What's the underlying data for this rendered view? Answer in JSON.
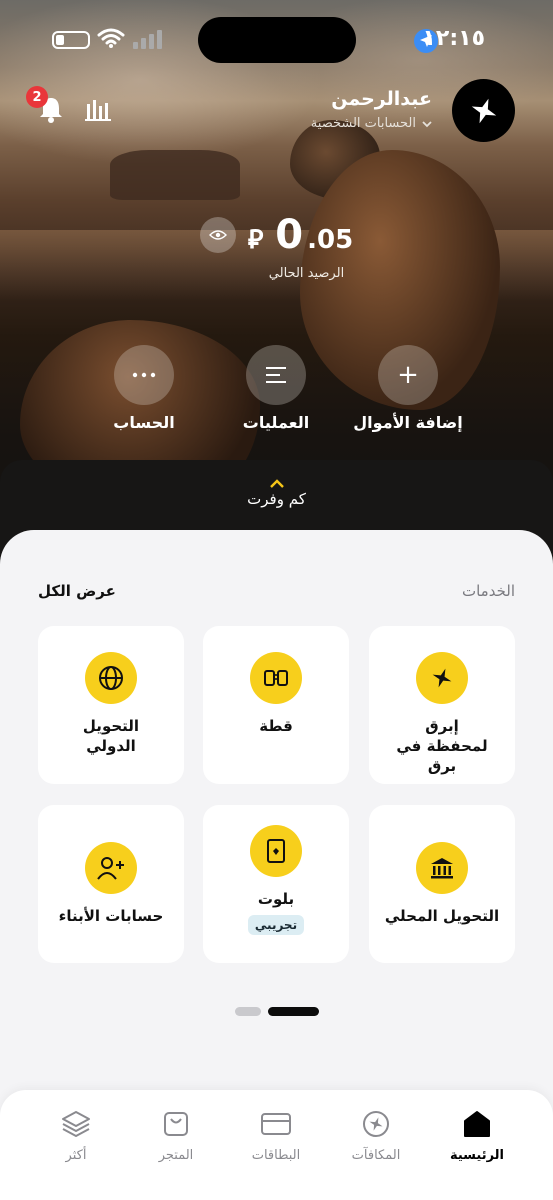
{
  "status_bar": {
    "time": "١٢:١٥"
  },
  "header": {
    "user_name": "عبدالرحمن",
    "account_type": "الحسابات الشخصية",
    "notifications_count": "2"
  },
  "balance": {
    "amount_whole": "0",
    "amount_decimal": ".05",
    "currency_symbol": "⃁",
    "label": "الرصيد الحالي"
  },
  "actions": [
    {
      "label": "إضافة الأموال",
      "icon": "plus-icon"
    },
    {
      "label": "العمليات",
      "icon": "list-icon"
    },
    {
      "label": "الحساب",
      "icon": "more-icon"
    }
  ],
  "savings": {
    "label": "كم وفرت"
  },
  "services": {
    "title": "الخدمات",
    "view_all": "عرض الكل",
    "cards": [
      {
        "name": "إبرق لمحفظة في برق",
        "icon": "sparkle-icon"
      },
      {
        "name": "قطة",
        "icon": "split-icon"
      },
      {
        "name": "التحويل الدولي",
        "icon": "globe-icon"
      },
      {
        "name": "التحويل المحلي",
        "icon": "bank-icon"
      },
      {
        "name": "بلوت",
        "icon": "cards-icon",
        "tag": "تجريبي"
      },
      {
        "name": "حسابات الأبناء",
        "icon": "add-user-icon"
      }
    ],
    "pagination": {
      "pages": 2,
      "current": 1
    }
  },
  "bottom_nav": [
    {
      "label": "الرئيسية",
      "icon": "home-icon",
      "active": true
    },
    {
      "label": "المكافآت",
      "icon": "rewards-icon",
      "active": false
    },
    {
      "label": "البطاقات",
      "icon": "card-icon",
      "active": false
    },
    {
      "label": "المتجر",
      "icon": "store-icon",
      "active": false
    },
    {
      "label": "أكثر",
      "icon": "layers-icon",
      "active": false
    }
  ],
  "colors": {
    "accent": "#f7cf1c",
    "badge": "#e9363a",
    "location": "#3b8df5"
  }
}
